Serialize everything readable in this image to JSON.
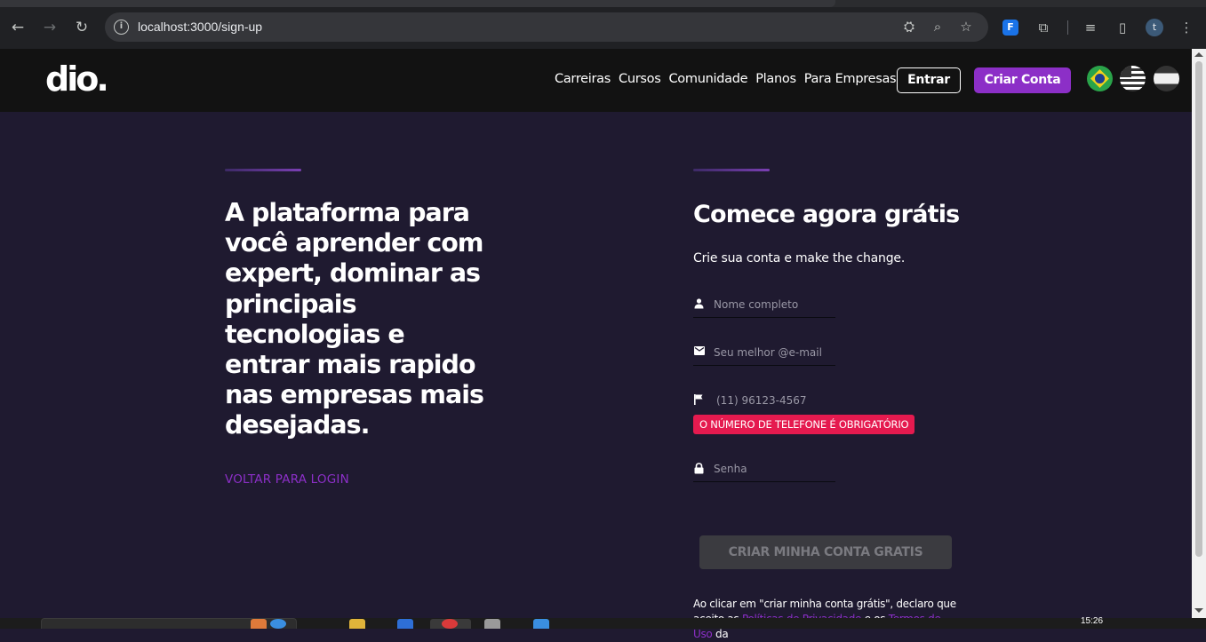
{
  "browser": {
    "url": "localhost:3000/sign-up",
    "icons": {
      "back": "arrow-left-icon",
      "forward": "arrow-right-icon",
      "reload": "reload-icon",
      "info": "info-icon",
      "translate": "translate-icon",
      "zoom": "zoom-icon",
      "bookmark": "star-icon",
      "extension": "extension-icon",
      "puzzle": "puzzle-icon",
      "media": "media-icon",
      "sidepanel": "side-panel-icon",
      "menu": "kebab-menu-icon"
    },
    "profile_initial": "t",
    "extension_label": "F"
  },
  "header": {
    "logo": "dio.",
    "nav": [
      "Carreiras",
      "Cursos",
      "Comunidade",
      "Planos",
      "Para Empresas"
    ],
    "login_label": "Entrar",
    "signup_label": "Criar Conta",
    "accent_color": "#8c2fc7",
    "flags": [
      "flag-brazil-icon",
      "flag-usa-icon",
      "flag-spain-icon"
    ]
  },
  "hero": {
    "title": "A plataforma para você aprender com expert, dominar as principais tecnologias e entrar mais rapido nas empresas mais desejadas.",
    "back_link": "VOLTAR PARA LOGIN"
  },
  "form": {
    "title": "Comece agora grátis",
    "subtitle": "Crie sua conta e make the change.",
    "fields": [
      {
        "placeholder": "Nome completo",
        "value": "",
        "icon": "person-icon"
      },
      {
        "placeholder": "Seu melhor @e-mail",
        "value": "",
        "icon": "mail-icon"
      },
      {
        "placeholder": "(11) 96123-4567",
        "value": "",
        "icon": "flag-icon"
      },
      {
        "placeholder": "Senha",
        "value": "",
        "icon": "lock-icon"
      }
    ],
    "phone_error": "O NÚMERO DE TELEFONE É OBRIGATÓRIO",
    "error_color": "#e51a4f",
    "submit_label": "CRIAR MINHA CONTA GRATIS",
    "terms_prefix": "Ao clicar em \"criar minha conta grátis\", declaro que aceito as ",
    "terms_privacy": "Políticas de Privacidade",
    "terms_mid": " e os ",
    "terms_use": "Termos de Uso",
    "terms_suffix": " da"
  },
  "taskbar": {
    "time": "15:26"
  }
}
